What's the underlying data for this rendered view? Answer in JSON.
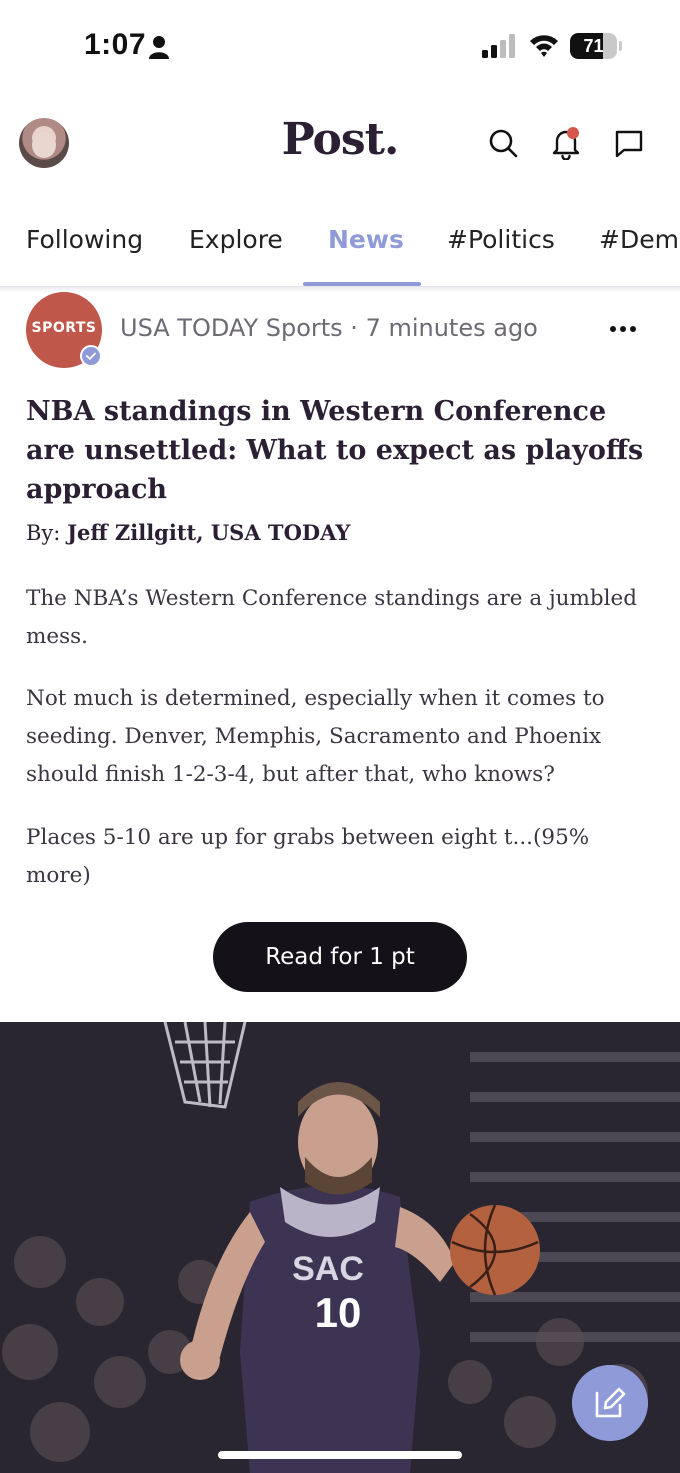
{
  "status_bar": {
    "time": "1:07",
    "battery": "71",
    "battery_level": 0.71
  },
  "header": {
    "brand": "Post."
  },
  "tabs": [
    {
      "label": "Following"
    },
    {
      "label": "Explore"
    },
    {
      "label": "News",
      "active": true
    },
    {
      "label": "#Politics"
    },
    {
      "label": "#Democ"
    }
  ],
  "post": {
    "source_avatar_label": "SPORTS",
    "source_line": "USA TODAY Sports · 7 minutes ago",
    "headline": "NBA standings in Western Conference are unsettled: What to expect as playoffs approach",
    "byline_prefix": "By:",
    "byline_author": "Jeff Zillgitt, USA TODAY",
    "paragraphs": [
      "The NBA’s Western Conference standings are a jumbled mess.",
      "Not much is determined, especially when it comes to seeding. Denver, Memphis, Sacramento and Phoenix should finish 1-2-3-4, but after that, who knows?",
      "Places 5-10 are up for grabs between eight t...(95% more)"
    ],
    "read_button": "Read for 1 pt",
    "photo_jersey_text": "SAC",
    "photo_jersey_number": "10"
  },
  "colors": {
    "accent": "#8f9bd8",
    "brand_text": "#2b1f33",
    "source_avatar": "#c0574b",
    "notification_dot": "#d5564c",
    "read_button": "#141118"
  },
  "icons": [
    "person-icon",
    "signal-icon",
    "wifi-icon",
    "search-icon",
    "bell-icon",
    "chat-icon",
    "more-icon",
    "verified-icon",
    "compose-icon"
  ]
}
